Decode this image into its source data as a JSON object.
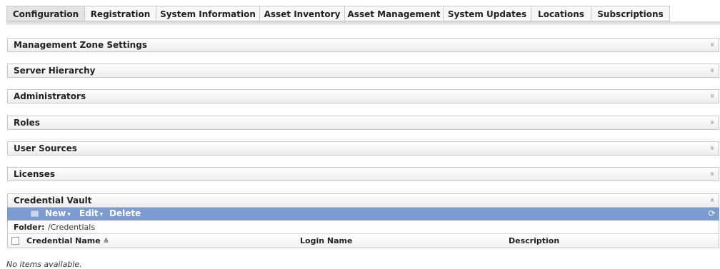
{
  "tabs": [
    {
      "label": "Configuration",
      "active": true
    },
    {
      "label": "Registration",
      "active": false
    },
    {
      "label": "System Information",
      "active": false
    },
    {
      "label": "Asset Inventory",
      "active": false
    },
    {
      "label": "Asset Management",
      "active": false
    },
    {
      "label": "System Updates",
      "active": false
    },
    {
      "label": "Locations",
      "active": false
    },
    {
      "label": "Subscriptions",
      "active": false
    }
  ],
  "sections": [
    {
      "title": "Management Zone Settings",
      "state": "collapsed",
      "chevron": "»"
    },
    {
      "title": "Server Hierarchy",
      "state": "collapsed",
      "chevron": "»"
    },
    {
      "title": "Administrators",
      "state": "collapsed",
      "chevron": "»"
    },
    {
      "title": "Roles",
      "state": "collapsed",
      "chevron": "»"
    },
    {
      "title": "User Sources",
      "state": "collapsed",
      "chevron": "»"
    },
    {
      "title": "Licenses",
      "state": "collapsed",
      "chevron": "»"
    },
    {
      "title": "Credential Vault",
      "state": "expanded",
      "chevron": "«"
    }
  ],
  "toolbar": {
    "new_label": "New",
    "edit_label": "Edit",
    "delete_label": "Delete",
    "caret": "▾",
    "refresh_glyph": "⟳",
    "icon": "folder-icon",
    "bg_color": "#7b9bd1"
  },
  "folder": {
    "label": "Folder:",
    "path": "/Credentials"
  },
  "table": {
    "columns": [
      {
        "label": "Credential Name",
        "sorted": "ascending",
        "sort_glyph": "≙"
      },
      {
        "label": "Login Name"
      },
      {
        "label": "Description"
      }
    ],
    "empty_message": "No items available."
  },
  "colors": {
    "accent": "#7b9bd1",
    "section_border": "#c8c8c8"
  }
}
